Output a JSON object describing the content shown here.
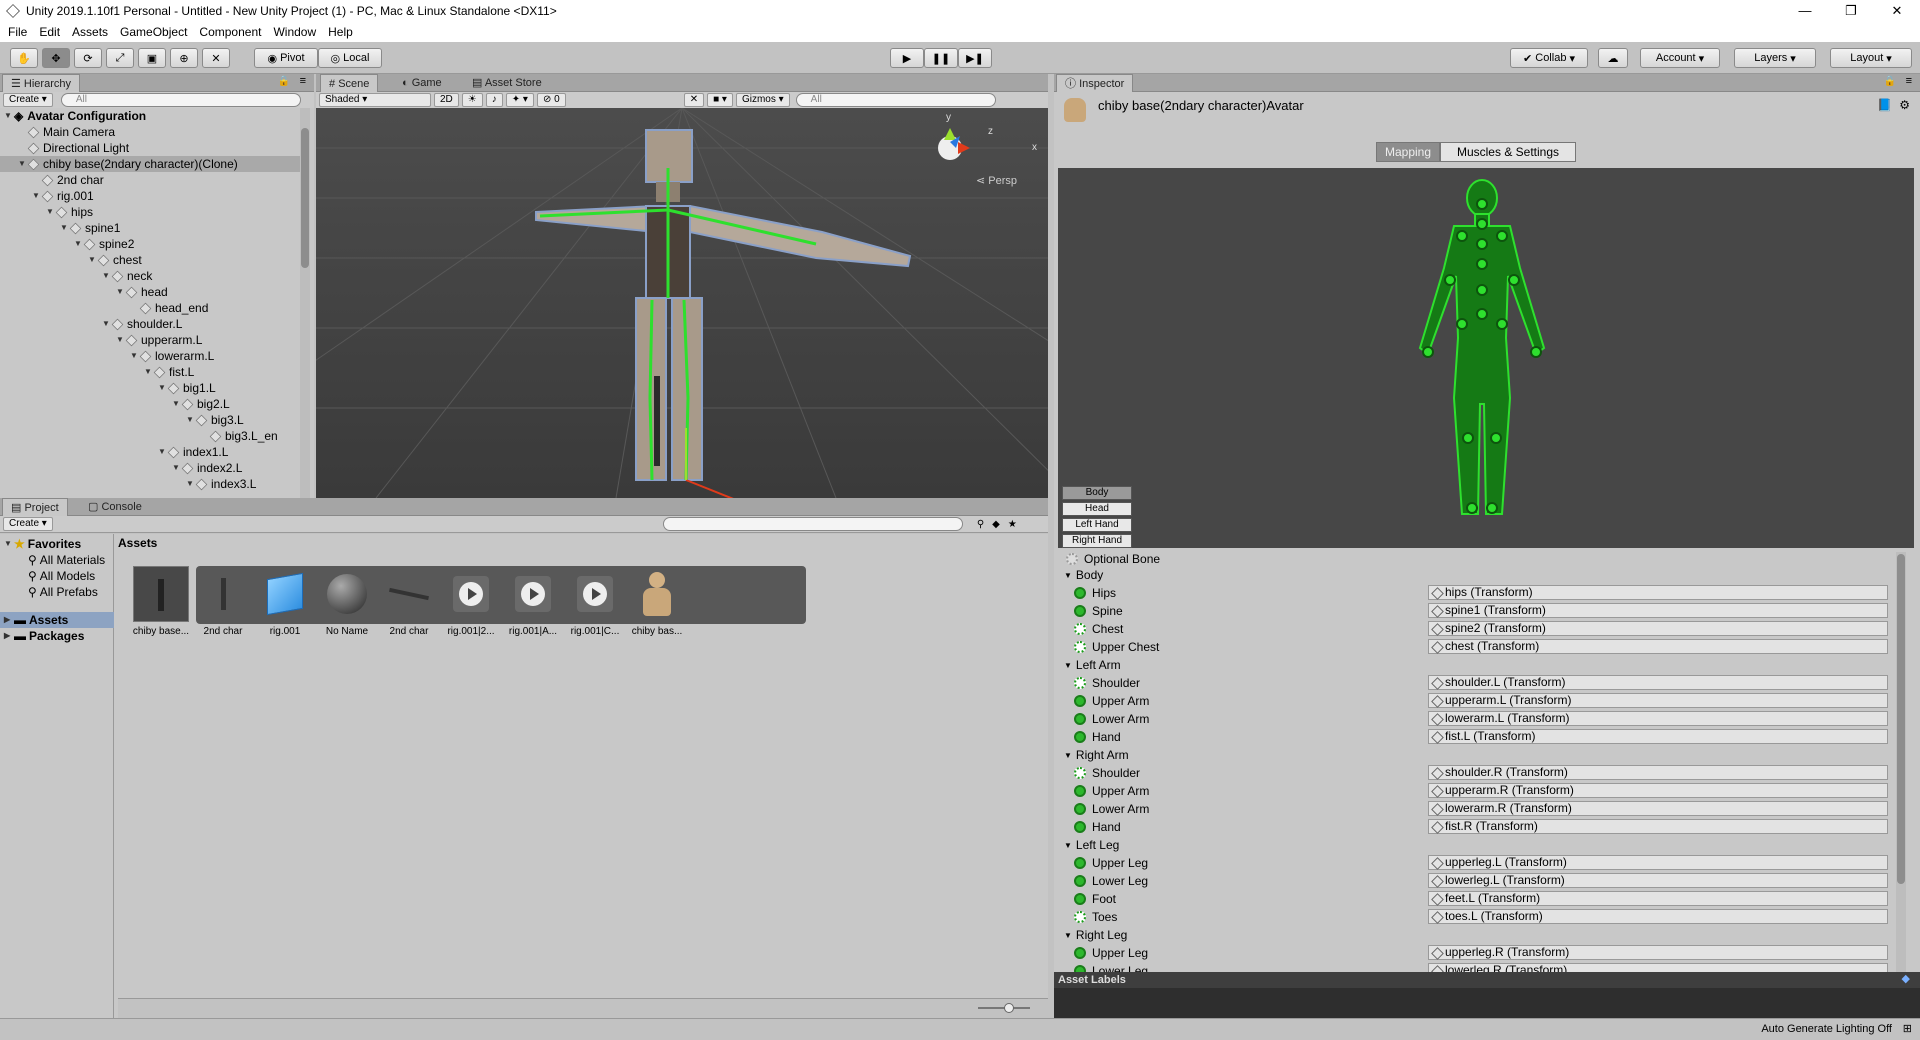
{
  "window": {
    "title": "Unity 2019.1.10f1 Personal - Untitled - New Unity Project (1) - PC, Mac & Linux Standalone <DX11>",
    "controls": [
      "—",
      "❐",
      "✕"
    ]
  },
  "menu": [
    "File",
    "Edit",
    "Assets",
    "GameObject",
    "Component",
    "Window",
    "Help"
  ],
  "toolbar": {
    "pivot": "Pivot",
    "local": "Local",
    "collab": "Collab",
    "account": "Account",
    "layers": "Layers",
    "layout": "Layout"
  },
  "hierarchy": {
    "tab": "Hierarchy",
    "create": "Create",
    "search_placeholder": "All",
    "scene_name": "Avatar Configuration",
    "items": [
      {
        "label": "Main Camera",
        "depth": 1,
        "expanded": null
      },
      {
        "label": "Directional Light",
        "depth": 1,
        "expanded": null
      },
      {
        "label": "chiby base(2ndary character)(Clone)",
        "depth": 1,
        "expanded": true,
        "selected": true
      },
      {
        "label": "2nd char",
        "depth": 2,
        "expanded": null
      },
      {
        "label": "rig.001",
        "depth": 2,
        "expanded": true
      },
      {
        "label": "hips",
        "depth": 3,
        "expanded": true
      },
      {
        "label": "spine1",
        "depth": 4,
        "expanded": true
      },
      {
        "label": "spine2",
        "depth": 5,
        "expanded": true
      },
      {
        "label": "chest",
        "depth": 6,
        "expanded": true
      },
      {
        "label": "neck",
        "depth": 7,
        "expanded": true
      },
      {
        "label": "head",
        "depth": 8,
        "expanded": true
      },
      {
        "label": "head_end",
        "depth": 9,
        "expanded": null
      },
      {
        "label": "shoulder.L",
        "depth": 7,
        "expanded": true
      },
      {
        "label": "upperarm.L",
        "depth": 8,
        "expanded": true
      },
      {
        "label": "lowerarm.L",
        "depth": 9,
        "expanded": true
      },
      {
        "label": "fist.L",
        "depth": 10,
        "expanded": true
      },
      {
        "label": "big1.L",
        "depth": 11,
        "expanded": true
      },
      {
        "label": "big2.L",
        "depth": 12,
        "expanded": true
      },
      {
        "label": "big3.L",
        "depth": 13,
        "expanded": true
      },
      {
        "label": "big3.L_en",
        "depth": 14,
        "expanded": null
      },
      {
        "label": "index1.L",
        "depth": 11,
        "expanded": true
      },
      {
        "label": "index2.L",
        "depth": 12,
        "expanded": true
      },
      {
        "label": "index3.L",
        "depth": 13,
        "expanded": true
      }
    ]
  },
  "scene": {
    "tabs": [
      "Scene",
      "Game",
      "Asset Store"
    ],
    "shading": "Shaded",
    "mode_2d": "2D",
    "fx_count": "0",
    "gizmos": "Gizmos",
    "search_placeholder": "All",
    "persp": "Persp",
    "axis_y": "y",
    "axis_z": "z",
    "axis_x": "x"
  },
  "project": {
    "tabs": [
      "Project",
      "Console"
    ],
    "create": "Create",
    "favorites_title": "Favorites",
    "favorites": [
      "All Materials",
      "All Models",
      "All Prefabs"
    ],
    "roots": [
      "Assets",
      "Packages"
    ],
    "breadcrumb": "Assets",
    "assets": [
      {
        "label": "chiby base...",
        "kind": "model"
      },
      {
        "label": "2nd char",
        "kind": "mesh"
      },
      {
        "label": "rig.001",
        "kind": "cube"
      },
      {
        "label": "No Name",
        "kind": "sphere"
      },
      {
        "label": "2nd char",
        "kind": "rig"
      },
      {
        "label": "rig.001|2...",
        "kind": "anim"
      },
      {
        "label": "rig.001|A...",
        "kind": "anim"
      },
      {
        "label": "rig.001|C...",
        "kind": "anim"
      },
      {
        "label": "chiby bas...",
        "kind": "avatar"
      }
    ]
  },
  "inspector": {
    "tab": "Inspector",
    "object_name": "chiby base(2ndary character)Avatar",
    "tabs": [
      "Mapping",
      "Muscles & Settings"
    ],
    "body_parts": [
      "Body",
      "Head",
      "Left Hand",
      "Right Hand"
    ],
    "optional_bone": "Optional Bone",
    "groups": [
      {
        "name": "Body",
        "bones": [
          {
            "label": "Hips",
            "value": "hips (Transform)",
            "optional": false
          },
          {
            "label": "Spine",
            "value": "spine1 (Transform)",
            "optional": false
          },
          {
            "label": "Chest",
            "value": "spine2 (Transform)",
            "optional": true
          },
          {
            "label": "Upper Chest",
            "value": "chest (Transform)",
            "optional": true
          }
        ]
      },
      {
        "name": "Left Arm",
        "bones": [
          {
            "label": "Shoulder",
            "value": "shoulder.L (Transform)",
            "optional": true
          },
          {
            "label": "Upper Arm",
            "value": "upperarm.L (Transform)",
            "optional": false
          },
          {
            "label": "Lower Arm",
            "value": "lowerarm.L (Transform)",
            "optional": false
          },
          {
            "label": "Hand",
            "value": "fist.L (Transform)",
            "optional": false
          }
        ]
      },
      {
        "name": "Right Arm",
        "bones": [
          {
            "label": "Shoulder",
            "value": "shoulder.R (Transform)",
            "optional": true
          },
          {
            "label": "Upper Arm",
            "value": "upperarm.R (Transform)",
            "optional": false
          },
          {
            "label": "Lower Arm",
            "value": "lowerarm.R (Transform)",
            "optional": false
          },
          {
            "label": "Hand",
            "value": "fist.R (Transform)",
            "optional": false
          }
        ]
      },
      {
        "name": "Left Leg",
        "bones": [
          {
            "label": "Upper Leg",
            "value": "upperleg.L (Transform)",
            "optional": false
          },
          {
            "label": "Lower Leg",
            "value": "lowerleg.L (Transform)",
            "optional": false
          },
          {
            "label": "Foot",
            "value": "feet.L (Transform)",
            "optional": false
          },
          {
            "label": "Toes",
            "value": "toes.L (Transform)",
            "optional": true
          }
        ]
      },
      {
        "name": "Right Leg",
        "bones": [
          {
            "label": "Upper Leg",
            "value": "upperleg.R (Transform)",
            "optional": false
          },
          {
            "label": "Lower Leg",
            "value": "lowerleg.R (Transform)",
            "optional": false
          }
        ]
      }
    ],
    "asset_labels": "Asset Labels"
  },
  "status": {
    "lighting": "Auto Generate Lighting Off"
  },
  "colors": {
    "bone_green": "#22c322",
    "scene_bg": "#474747",
    "panel": "#c8c8c8"
  }
}
